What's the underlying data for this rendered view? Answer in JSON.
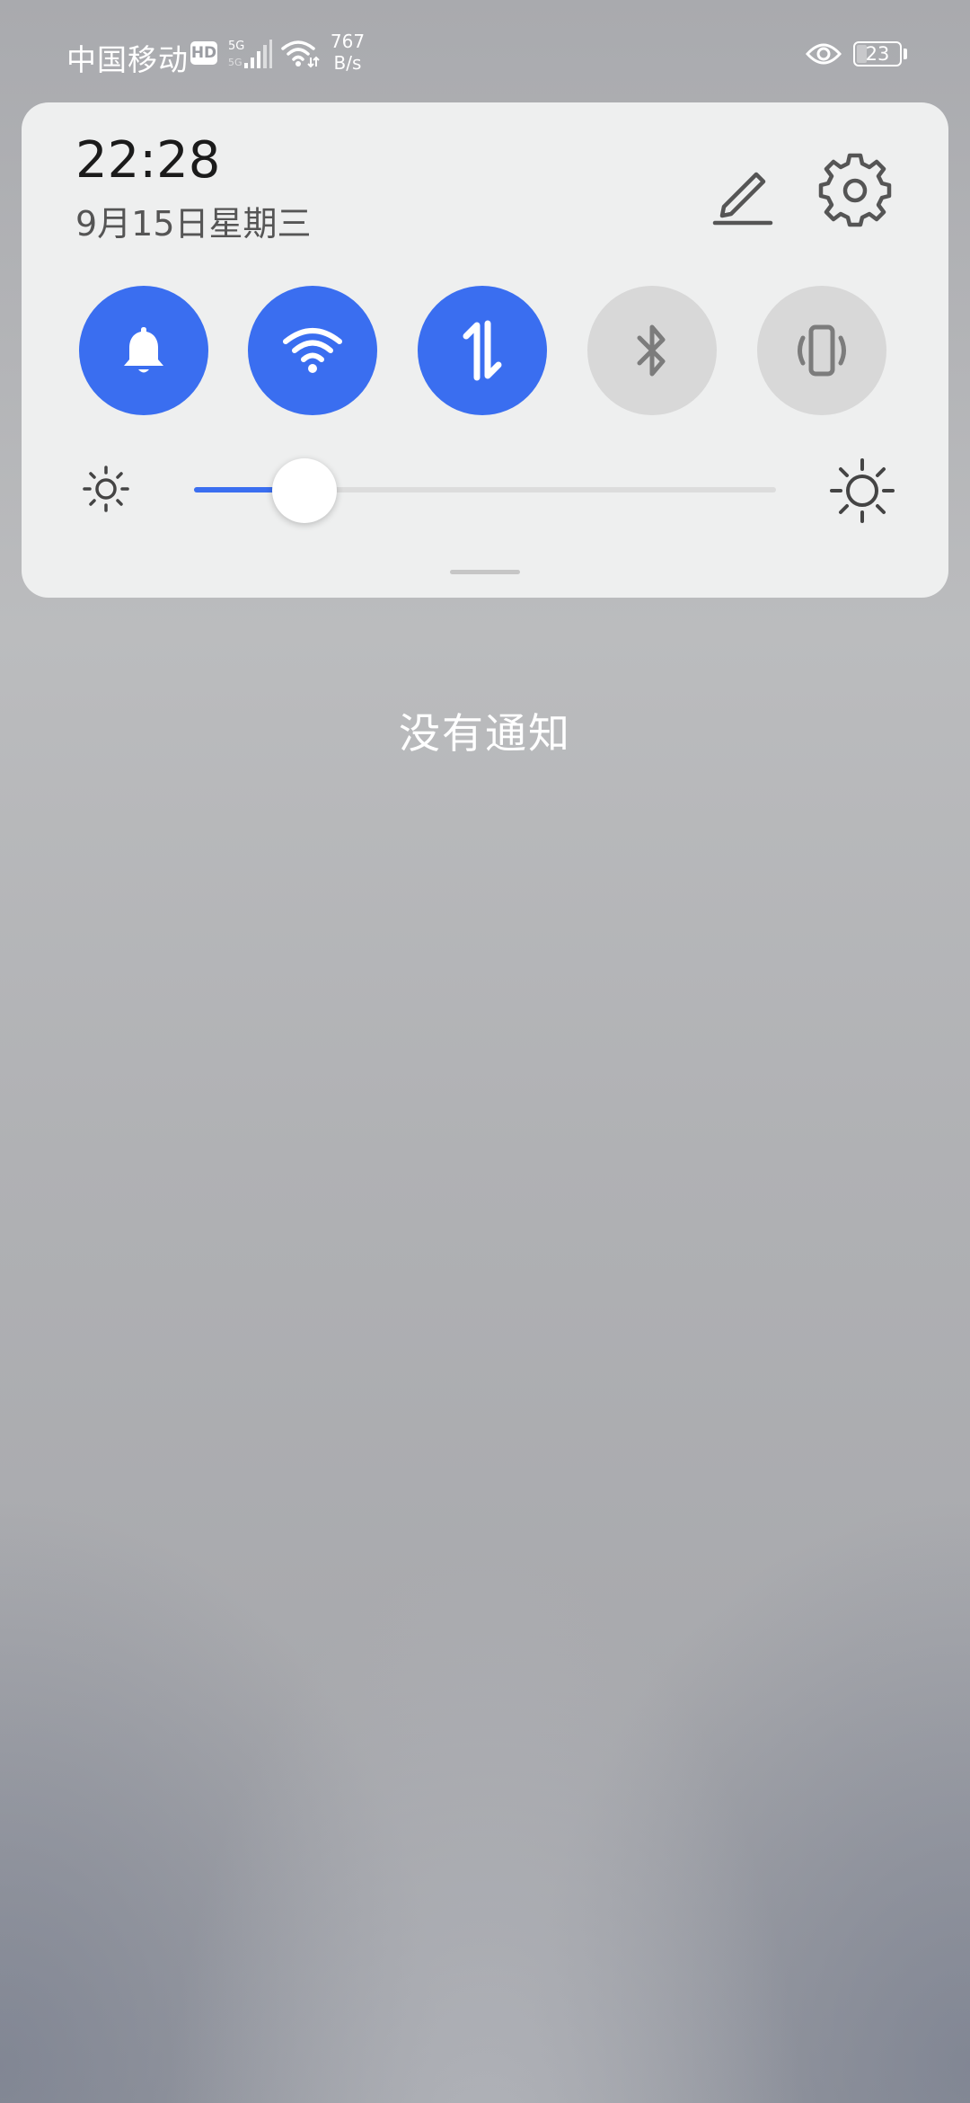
{
  "status_bar": {
    "carrier": "中国移动",
    "hd": "HD",
    "network": "5G",
    "speed_value": "767",
    "speed_unit": "B/s",
    "battery": "23",
    "battery_level": 0.23,
    "icons": [
      "hd-icon",
      "signal-icon",
      "wifi-icon",
      "eye-icon",
      "battery-icon"
    ]
  },
  "quick_settings": {
    "time": "22:28",
    "date": "9月15日星期三",
    "edit_icon": "pencil-icon",
    "settings_icon": "gear-icon",
    "toggles": [
      {
        "id": "sound",
        "icon": "bell-icon",
        "state": "on"
      },
      {
        "id": "wifi",
        "icon": "wifi-icon",
        "state": "on"
      },
      {
        "id": "mobile-data",
        "icon": "data-transfer-icon",
        "state": "on"
      },
      {
        "id": "bluetooth",
        "icon": "bluetooth-icon",
        "state": "off"
      },
      {
        "id": "vibrate",
        "icon": "vibrate-icon",
        "state": "off"
      }
    ],
    "brightness": {
      "level": 0.19,
      "low_icon": "sun-small-icon",
      "high_icon": "sun-large-icon"
    },
    "colors": {
      "accent": "#3a6ef0",
      "toggle_off": "#d8d8d8",
      "panel": "#eeefef"
    }
  },
  "notifications": {
    "empty_text": "没有通知"
  }
}
